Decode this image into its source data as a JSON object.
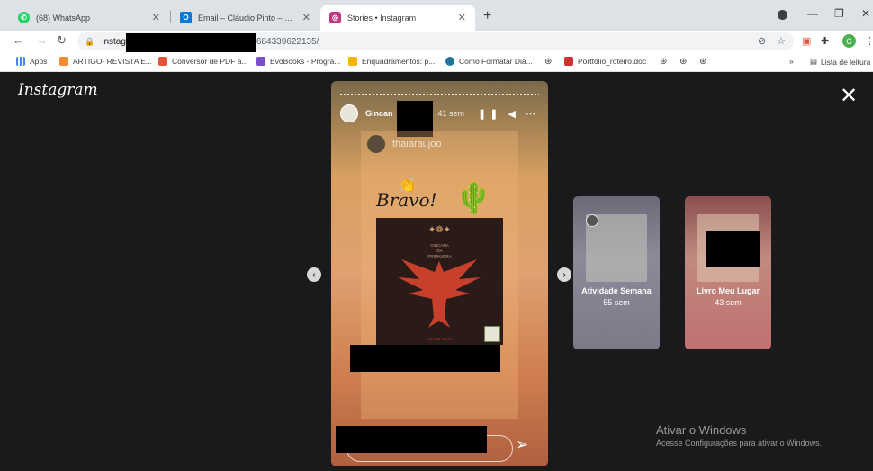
{
  "tabs": [
    {
      "title": "(68) WhatsApp",
      "icon": "whatsapp-icon",
      "color": "#25d366"
    },
    {
      "title": "Email – Cláudio Pinto – Outlook",
      "icon": "outlook-icon",
      "color": "#0078d4"
    },
    {
      "title": "Stories • Instagram",
      "icon": "instagram-icon",
      "color": "#c13584"
    }
  ],
  "toolbar": {
    "url_prefix": "instag",
    "url_suffix": "684339622135/"
  },
  "account_initial": "C",
  "bookmarks": [
    {
      "label": "Apps",
      "icon": "apps-grid-icon",
      "color": "#4285f4"
    },
    {
      "label": "ARTIGO- REVISTA E...",
      "icon": "bookmark-icon",
      "color": "#f28b30"
    },
    {
      "label": "Conversor de PDF a...",
      "icon": "pdf-icon",
      "color": "#e5533d"
    },
    {
      "label": "EvoBooks - Progra...",
      "icon": "evobooks-icon",
      "color": "#7b4fc8"
    },
    {
      "label": "Enquadramentos: p...",
      "icon": "bookmark-icon",
      "color": "#f4b400"
    },
    {
      "label": "Como Formatar Diá...",
      "icon": "wordpress-icon",
      "color": "#21759b"
    },
    {
      "label": "Portfolio_roteiro.doc",
      "icon": "doc-icon",
      "color": "#d32f2f"
    }
  ],
  "bookmarks_more": "»",
  "reading_list": "Lista de leitura",
  "brand": "Instagram",
  "story": {
    "user": "Gincan",
    "time": "41 sem",
    "mention": "thaiaraujoo",
    "sticker_text": "Bravo!",
    "poster_title_1": "GINCANA",
    "poster_title_2": "DA",
    "poster_title_3": "PRIMAVERA",
    "poster_footer": "EQUIPE FÊNIX"
  },
  "next_stories": [
    {
      "label": "Atividade Semana",
      "time": "55 sem"
    },
    {
      "label": "Livro Meu Lugar",
      "time": "43 sem"
    }
  ],
  "windows_activation": {
    "title": "Ativar o Windows",
    "subtitle": "Acesse Configurações para ativar o Windows."
  }
}
